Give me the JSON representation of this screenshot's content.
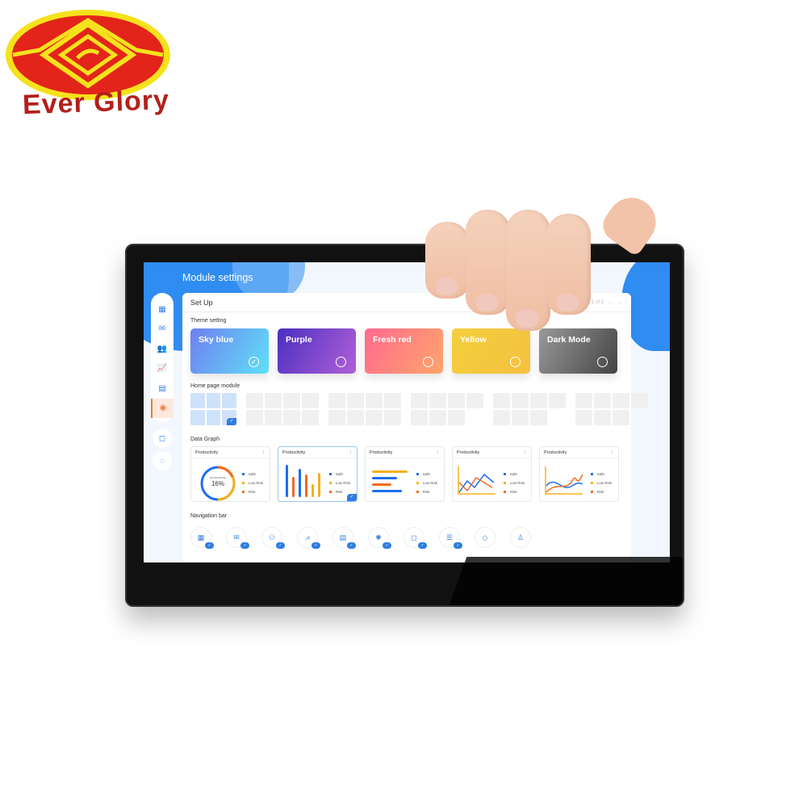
{
  "brand": {
    "name": "Ever Glory",
    "colors": {
      "red": "#e3241a",
      "yellow": "#f5e21c",
      "text": "#b3201a"
    }
  },
  "app": {
    "title": "Module settings",
    "panel_title": "Set Up",
    "pager": {
      "text": "1 of 3",
      "prev_icon": "arrow-left-icon",
      "next_icon": "arrow-right-icon"
    },
    "sidebar": [
      {
        "icon": "dashboard-icon",
        "glyph": "▦"
      },
      {
        "icon": "mail-icon",
        "glyph": "✉"
      },
      {
        "icon": "users-icon",
        "glyph": "👥"
      },
      {
        "icon": "chart-icon",
        "glyph": "📈"
      },
      {
        "icon": "calendar-icon",
        "glyph": "▤"
      },
      {
        "icon": "settings-icon",
        "glyph": "◉",
        "active": true
      }
    ],
    "sidebar_extra": [
      {
        "icon": "note-icon",
        "glyph": "◻"
      },
      {
        "icon": "chat-icon",
        "glyph": "◌"
      }
    ],
    "sections": {
      "theme": "Theme setting",
      "home": "Home page module",
      "graph": "Data Graph",
      "nav": "Navigation bar"
    },
    "themes": [
      {
        "label": "Sky blue",
        "selected": true,
        "bg": "linear-gradient(120deg,#6f7ff0,#5fe0f7)"
      },
      {
        "label": "Purple",
        "selected": false,
        "bg": "linear-gradient(120deg,#4b2fc0,#b060d8)"
      },
      {
        "label": "Fresh red",
        "selected": false,
        "bg": "linear-gradient(120deg,#ff6a8f,#ffa56a)"
      },
      {
        "label": "Yellow",
        "selected": false,
        "bg": "linear-gradient(120deg,#f3cf3c,#f5c040)"
      },
      {
        "label": "Dark Mode",
        "selected": false,
        "bg": "linear-gradient(120deg,#999,#444)"
      }
    ],
    "graphs": [
      {
        "title": "Productivity",
        "type": "donut",
        "center_label": "productivity",
        "value": "16%"
      },
      {
        "title": "Productivity",
        "type": "bars",
        "selected": true
      },
      {
        "title": "Productivity",
        "type": "hbars"
      },
      {
        "title": "Productivity",
        "type": "line"
      },
      {
        "title": "Productivity",
        "type": "curve"
      }
    ],
    "legend": [
      {
        "label": "Safe",
        "color": "#1e6ef0"
      },
      {
        "label": "Low Risk",
        "color": "#f5b01c"
      },
      {
        "label": "Risk",
        "color": "#f56a1c"
      }
    ],
    "nav_icons": [
      {
        "icon": "dashboard-icon",
        "glyph": "▦",
        "checked": true
      },
      {
        "icon": "mail-icon",
        "glyph": "✉",
        "checked": true
      },
      {
        "icon": "users-icon",
        "glyph": "⚇",
        "checked": true
      },
      {
        "icon": "chart-icon",
        "glyph": "⩘",
        "checked": true
      },
      {
        "icon": "calendar-icon",
        "glyph": "▤",
        "checked": true
      },
      {
        "icon": "settings-icon",
        "glyph": "✺",
        "checked": true
      },
      {
        "icon": "note-icon",
        "glyph": "◻",
        "checked": true
      },
      {
        "icon": "chat-icon",
        "glyph": "☰",
        "checked": true
      },
      {
        "icon": "tag-icon",
        "glyph": "◇",
        "checked": false
      },
      {
        "icon": "user-icon",
        "glyph": "♙",
        "checked": false
      }
    ]
  }
}
